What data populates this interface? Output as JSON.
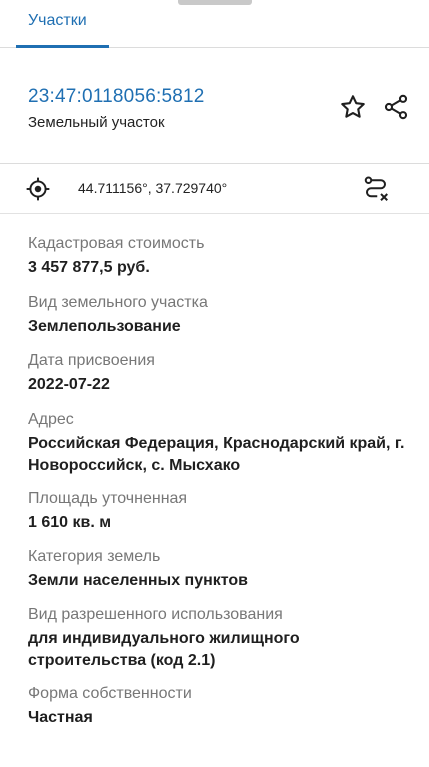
{
  "tabs": [
    {
      "label": "Участки",
      "active": true
    }
  ],
  "header": {
    "cadastral_number": "23:47:0118056:5812",
    "object_type": "Земельный участок"
  },
  "location": {
    "coordinates": "44.711156°, 37.729740°"
  },
  "details": [
    {
      "label": "Кадастровая стоимость",
      "value": "3 457 877,5 руб."
    },
    {
      "label": "Вид земельного участка",
      "value": "Землепользование"
    },
    {
      "label": "Дата присвоения",
      "value": "2022-07-22"
    },
    {
      "label": "Адрес",
      "value": "Российская Федерация, Краснодарский край, г. Новороссийск, с. Мысхако"
    },
    {
      "label": "Площадь уточненная",
      "value": "1 610 кв. м"
    },
    {
      "label": "Категория земель",
      "value": "Земли населенных пунктов"
    },
    {
      "label": "Вид разрешенного использования",
      "value": "для индивидуального жилищного строительства (код 2.1)"
    },
    {
      "label": "Форма собственности",
      "value": "Частная"
    }
  ],
  "icons": {
    "favorite": "star-icon",
    "share": "share-icon",
    "locate": "crosshair-icon",
    "route": "route-icon"
  },
  "colors": {
    "accent": "#1f6fb2",
    "label": "#777777",
    "value": "#1f1f1f",
    "divider": "#dcdcdc"
  }
}
